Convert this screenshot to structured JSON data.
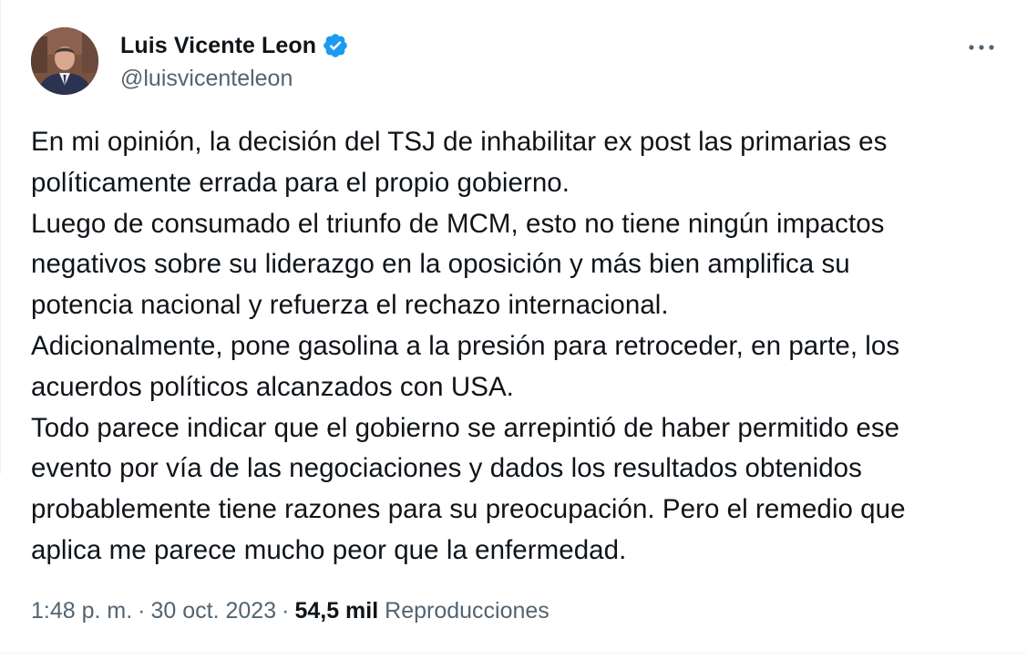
{
  "author": {
    "display_name": "Luis Vicente Leon",
    "handle": "@luisvicenteleon",
    "verified": true,
    "verified_icon": "verified-badge-icon",
    "avatar": "profile-photo"
  },
  "tweet": {
    "lines": [
      "En mi opinión, la decisión del TSJ de inhabilitar ex post las primarias es",
      "políticamente errada para el propio gobierno.",
      "Luego de consumado el triunfo de MCM, esto no tiene ningún impactos",
      "negativos sobre su liderazgo en la oposición y más bien amplifica su",
      "potencia nacional y refuerza el rechazo internacional.",
      "Adicionalmente, pone gasolina a la presión para retroceder, en parte, los",
      "acuerdos políticos alcanzados con USA.",
      "Todo parece indicar que el gobierno se arrepintió de haber permitido ese",
      "evento por vía de las negociaciones y dados los resultados obtenidos",
      "probablemente tiene razones para su preocupación. Pero el remedio que",
      "aplica me parece mucho peor que la enfermedad."
    ]
  },
  "meta": {
    "time": "1:48 p. m.",
    "separator": "·",
    "date": "30 oct. 2023",
    "views_count": "54,5 mil",
    "views_label": "Reproducciones"
  },
  "colors": {
    "text": "#0f1419",
    "secondary": "#536471",
    "verified": "#1d9bf0",
    "divider": "#eff3f4"
  },
  "icons": {
    "more": "more-horizontal-icon"
  }
}
